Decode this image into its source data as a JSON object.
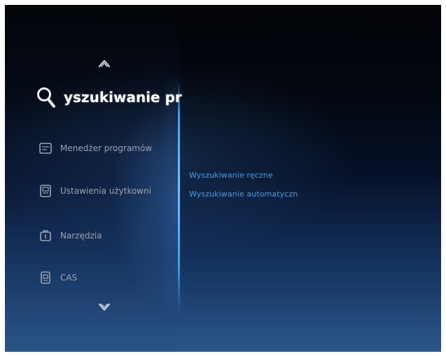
{
  "left_menu": {
    "selected": {
      "label": "yszukiwanie pr",
      "icon": "search-icon"
    },
    "items": [
      {
        "label": "Menedżer programów",
        "icon": "program-manager-icon"
      },
      {
        "label": "Ustawienia użytkowni",
        "icon": "user-settings-icon"
      },
      {
        "label": "Narzędzia",
        "icon": "tools-icon"
      },
      {
        "label": "CAS",
        "icon": "cas-card-icon"
      }
    ],
    "nav": {
      "up": "chevron-up-icon",
      "down": "chevron-down-icon"
    }
  },
  "submenu": {
    "items": [
      {
        "label": "Wyszukiwanie ręczne"
      },
      {
        "label": "Wyszukiwanie automatyczn"
      }
    ]
  },
  "colors": {
    "submenu_text": "#3e9ee8",
    "menu_text": "#9aa4b0",
    "selected_text": "#ffffff",
    "divider": "#79c0ff"
  }
}
